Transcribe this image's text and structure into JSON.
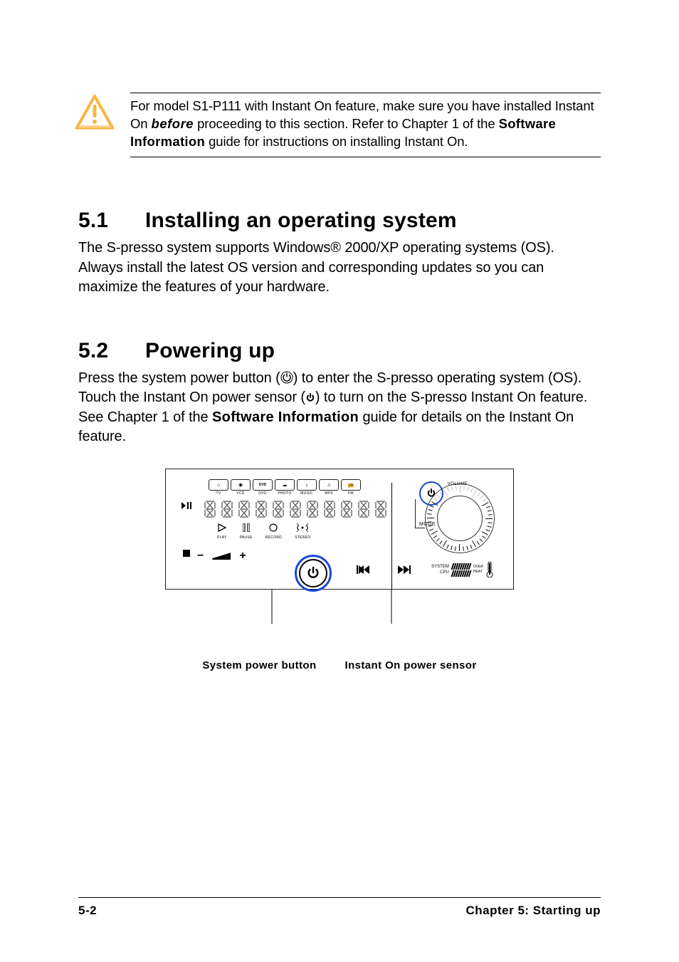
{
  "note": {
    "line1a": "For model S1-P111 with Instant On feature, make sure you have installed Instant On ",
    "before": "before",
    "line1b": " proceeding to this section. Refer to Chapter 1 of the ",
    "swinfo": "Software Information",
    "line1c": " guide for instructions on installing Instant On."
  },
  "section51": {
    "num": "5.1",
    "title": "Installing an operating system",
    "body": "The S-presso system supports Windows® 2000/XP operating systems (OS). Always install the latest OS version and corresponding updates so you can maximize the features of your hardware."
  },
  "section52": {
    "num": "5.2",
    "title": "Powering up",
    "p1a": "Press the system power button (",
    "p1b": ") to enter the S-presso operating system (OS). Touch the Instant On power sensor (",
    "p1c": ") to turn on the S-presso Instant On feature. See Chapter 1 of the ",
    "swinfo": "Software Information",
    "p1d": " guide for details on the Instant On feature."
  },
  "diagram": {
    "tabs": [
      "TV",
      "VCD",
      "DVD",
      "PHOTO",
      "MUSIC",
      "MP3",
      "FM"
    ],
    "lower": [
      "PLAY",
      "PAUSE",
      "RECORD",
      "STEREO"
    ],
    "mode": "MODE",
    "volume": "VOLUME",
    "system": "SYSTEM",
    "cpu": "CPU",
    "over": "OVER",
    "heat": "HEAT",
    "caption1": "System power button",
    "caption2": "Instant On power sensor"
  },
  "footer": {
    "left": "5-2",
    "right": "Chapter 5: Starting up"
  }
}
